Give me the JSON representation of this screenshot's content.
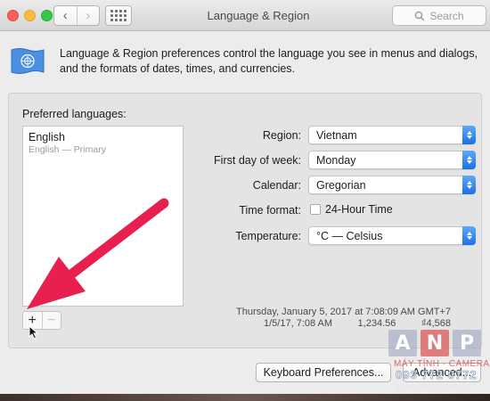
{
  "window": {
    "title": "Language & Region"
  },
  "toolbar": {
    "back_glyph": "‹",
    "forward_glyph": "›",
    "search_placeholder": "Search"
  },
  "header": {
    "icon": "un-flag-icon",
    "description": "Language & Region preferences control the language you see in menus and dialogs, and the formats of dates, times, and currencies."
  },
  "languages": {
    "label": "Preferred languages:",
    "items": [
      {
        "name": "English",
        "subtitle": "English — Primary"
      }
    ],
    "add_label": "+",
    "remove_label": "−"
  },
  "settings": {
    "region": {
      "label": "Region:",
      "value": "Vietnam"
    },
    "first_day": {
      "label": "First day of week:",
      "value": "Monday"
    },
    "calendar": {
      "label": "Calendar:",
      "value": "Gregorian"
    },
    "time_format": {
      "label": "Time format:",
      "checkbox_label": "24-Hour Time",
      "checked": false
    },
    "temperature": {
      "label": "Temperature:",
      "value": "°C — Celsius"
    }
  },
  "sample": {
    "long_date": "Thursday, January 5, 2017 at 7:08:09 AM GMT+7",
    "short_date": "1/5/17, 7:08 AM",
    "number": "1,234.56",
    "currency": "₫4,568"
  },
  "buttons": {
    "keyboard": "Keyboard Preferences...",
    "advanced": "Advanced..."
  },
  "watermark": {
    "letters": [
      "A",
      "N",
      "P"
    ],
    "line1": "MÁY TÍNH - CAMERA",
    "line2": "093 772 0772",
    "line3": "WWW.ANP.COM.VN"
  },
  "colors": {
    "accent": "#1b72e6",
    "annotation_arrow": "#e8204f"
  }
}
